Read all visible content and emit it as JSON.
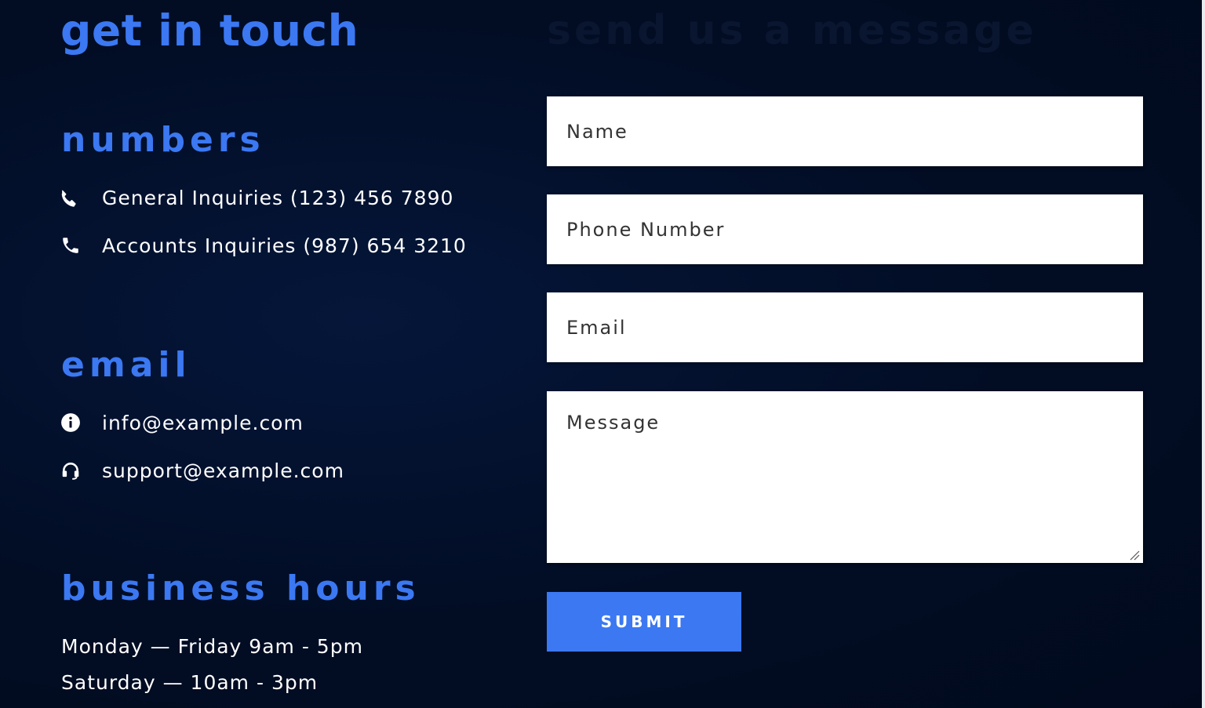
{
  "contact": {
    "title": "get in touch",
    "numbers": {
      "title": "numbers",
      "items": [
        {
          "icon": "phone-icon",
          "text": "General Inquiries (123) 456 7890"
        },
        {
          "icon": "phone-handset-icon",
          "text": "Accounts Inquiries (987) 654 3210"
        }
      ]
    },
    "email": {
      "title": "email",
      "items": [
        {
          "icon": "info-icon",
          "text": "info@example.com"
        },
        {
          "icon": "headset-icon",
          "text": "support@example.com"
        }
      ]
    },
    "hours": {
      "title": "business hours",
      "lines": [
        "Monday — Friday 9am - 5pm",
        "Saturday — 10am - 3pm"
      ]
    }
  },
  "form": {
    "title": "send us a message",
    "name_placeholder": "Name",
    "phone_placeholder": "Phone Number",
    "email_placeholder": "Email",
    "message_placeholder": "Message",
    "submit_label": "SUBMIT"
  },
  "colors": {
    "background": "#020d24",
    "accent": "#3b78f2",
    "text": "#ffffff",
    "field_background": "#ffffff"
  }
}
